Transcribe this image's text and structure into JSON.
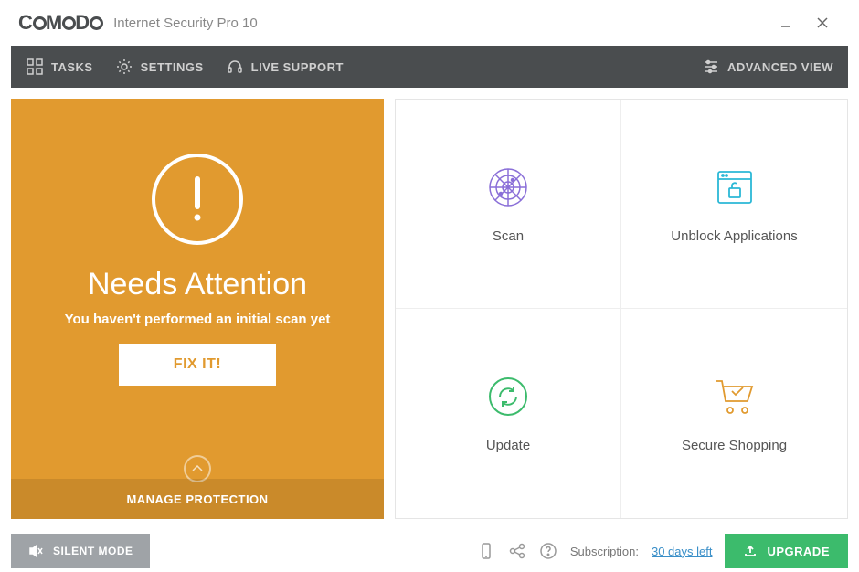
{
  "header": {
    "brand": "COMODO",
    "app_name": "Internet Security Pro 10"
  },
  "menubar": {
    "tasks": "TASKS",
    "settings": "SETTINGS",
    "live_support": "LIVE SUPPORT",
    "advanced_view": "ADVANCED VIEW"
  },
  "status": {
    "title": "Needs Attention",
    "subtitle": "You haven't performed an initial scan yet",
    "fix_label": "FIX IT!",
    "manage_label": "MANAGE PROTECTION"
  },
  "tiles": {
    "scan": "Scan",
    "unblock": "Unblock Applications",
    "update": "Update",
    "shopping": "Secure Shopping"
  },
  "footer": {
    "silent_mode": "SILENT MODE",
    "subscription_label": "Subscription:",
    "subscription_link": "30 days left",
    "upgrade": "UPGRADE"
  }
}
